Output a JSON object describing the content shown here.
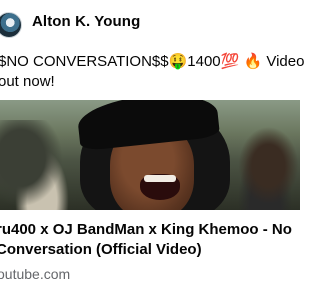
{
  "post": {
    "author": "Alton K. Young",
    "caption": "$NO CONVERSATION$$🤑1400💯 🔥 Video out now!"
  },
  "link_preview": {
    "title": "ru400 x OJ BandMan x King Khemoo - No Conversation (Official Video)",
    "domain": "outube.com"
  },
  "icons": {
    "avatar": "profile-avatar",
    "thumbnail": "video-thumbnail"
  }
}
